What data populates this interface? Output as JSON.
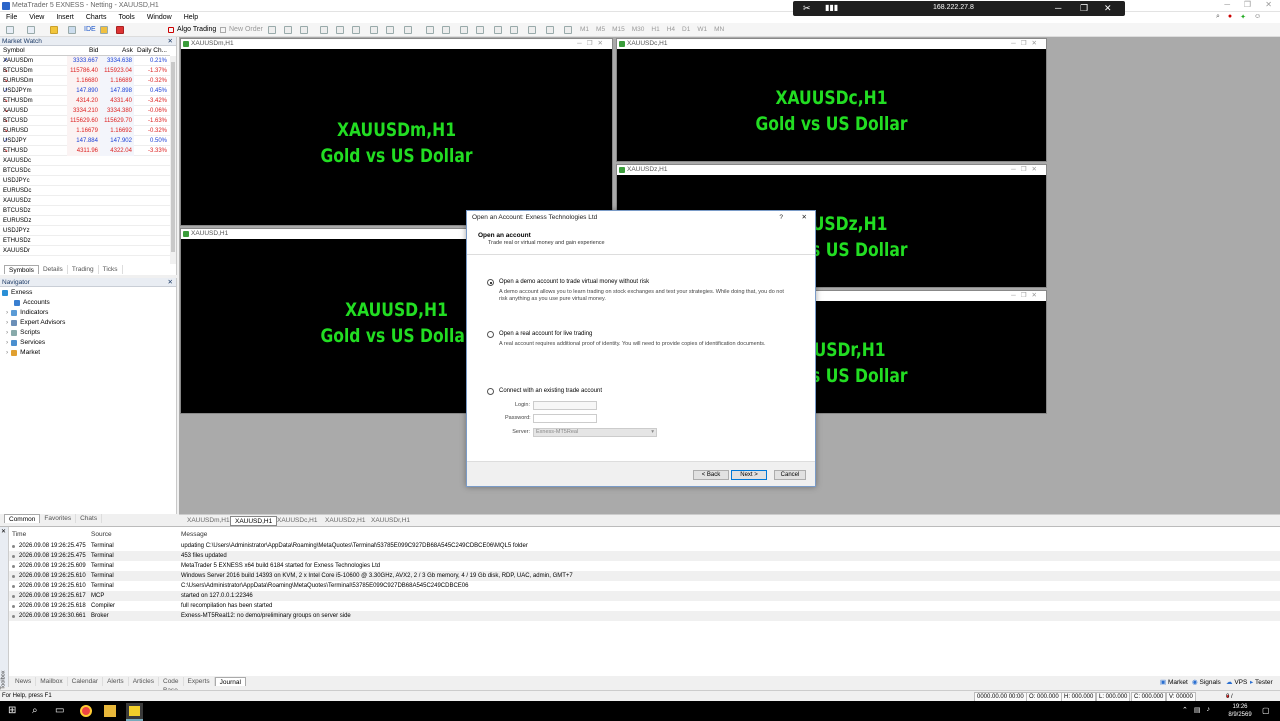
{
  "window": {
    "title": "MetaTrader 5 EXNESS - Netting - XAUUSD,H1"
  },
  "menu": [
    "File",
    "View",
    "Insert",
    "Charts",
    "Tools",
    "Window",
    "Help"
  ],
  "toolbar": {
    "ide": "IDE",
    "algo_trading": "Algo Trading",
    "new_order": "New Order",
    "timeframes": [
      "M1",
      "M5",
      "M15",
      "M30",
      "H1",
      "H4",
      "D1",
      "W1",
      "MN"
    ]
  },
  "rdp": {
    "ip": "168.222.27.8"
  },
  "market_watch": {
    "title": "Market Watch",
    "columns": [
      "Symbol",
      "Bid",
      "Ask",
      "Daily Ch..."
    ],
    "rows": [
      {
        "symbol": "XAUUSDm",
        "bid": "3333.667",
        "ask": "3334.638",
        "change": "0.21%",
        "dir": "up"
      },
      {
        "symbol": "BTCUSDm",
        "bid": "115786.40",
        "ask": "115923.04",
        "change": "-1.37%",
        "dir": "down"
      },
      {
        "symbol": "EURUSDm",
        "bid": "1.16680",
        "ask": "1.16689",
        "change": "-0.32%",
        "dir": "down"
      },
      {
        "symbol": "USDJPYm",
        "bid": "147.890",
        "ask": "147.898",
        "change": "0.45%",
        "dir": "up"
      },
      {
        "symbol": "ETHUSDm",
        "bid": "4314.20",
        "ask": "4331.40",
        "change": "-3.42%",
        "dir": "down"
      },
      {
        "symbol": "XAUUSD",
        "bid": "3334.210",
        "ask": "3334.380",
        "change": "-0.06%",
        "dir": "down"
      },
      {
        "symbol": "BTCUSD",
        "bid": "115629.60",
        "ask": "115629.70",
        "change": "-1.63%",
        "dir": "down"
      },
      {
        "symbol": "EURUSD",
        "bid": "1.16679",
        "ask": "1.16692",
        "change": "-0.32%",
        "dir": "down"
      },
      {
        "symbol": "USDJPY",
        "bid": "147.884",
        "ask": "147.902",
        "change": "0.50%",
        "dir": "up"
      },
      {
        "symbol": "ETHUSD",
        "bid": "4311.96",
        "ask": "4322.04",
        "change": "-3.33%",
        "dir": "down"
      },
      {
        "symbol": "XAUUSDc",
        "bid": "",
        "ask": "",
        "change": "",
        "dir": ""
      },
      {
        "symbol": "BTCUSDc",
        "bid": "",
        "ask": "",
        "change": "",
        "dir": ""
      },
      {
        "symbol": "USDJPYc",
        "bid": "",
        "ask": "",
        "change": "",
        "dir": ""
      },
      {
        "symbol": "EURUSDc",
        "bid": "",
        "ask": "",
        "change": "",
        "dir": ""
      },
      {
        "symbol": "XAUUSDz",
        "bid": "",
        "ask": "",
        "change": "",
        "dir": ""
      },
      {
        "symbol": "BTCUSDz",
        "bid": "",
        "ask": "",
        "change": "",
        "dir": ""
      },
      {
        "symbol": "EURUSDz",
        "bid": "",
        "ask": "",
        "change": "",
        "dir": ""
      },
      {
        "symbol": "USDJPYz",
        "bid": "",
        "ask": "",
        "change": "",
        "dir": ""
      },
      {
        "symbol": "ETHUSDz",
        "bid": "",
        "ask": "",
        "change": "",
        "dir": ""
      },
      {
        "symbol": "XAUUSDr",
        "bid": "",
        "ask": "",
        "change": "",
        "dir": ""
      }
    ],
    "tabs": [
      "Symbols",
      "Details",
      "Trading",
      "Ticks"
    ]
  },
  "navigator": {
    "title": "Navigator",
    "items": [
      "Exness",
      "Accounts",
      "Indicators",
      "Expert Advisors",
      "Scripts",
      "Services",
      "Market"
    ],
    "tabs": [
      "Common",
      "Favorites",
      "Chats"
    ]
  },
  "charts": [
    {
      "header": "XAUUSDm,H1",
      "line1": "XAUUSDm,H1",
      "line2": "Gold vs US Dollar"
    },
    {
      "header": "XAUUSDc,H1",
      "line1": "XAUUSDc,H1",
      "line2": "Gold vs US Dollar"
    },
    {
      "header": "XAUUSDz,H1",
      "line1": "XAUUSDz,H1",
      "line2": "Gold vs US Dollar"
    },
    {
      "header": "XAUUSD,H1",
      "line1": "XAUUSD,H1",
      "line2": "Gold vs US Dollar"
    },
    {
      "header": "",
      "line1": "XAUUSDr,H1",
      "line2": "Gold vs US Dollar"
    }
  ],
  "chart_tabs": [
    "XAUUSDm,H1",
    "XAUUSD,H1",
    "XAUUSDc,H1",
    "XAUUSDz,H1",
    "XAUUSDr,H1"
  ],
  "dialog": {
    "title": "Open an Account: Exness Technologies Ltd",
    "help": "?",
    "close": "✕",
    "heading": "Open an account",
    "subheading": "Trade real or virtual money and gain experience",
    "opt_demo": "Open a demo account to trade virtual money without risk",
    "opt_demo_desc": "A demo account allows you to learn trading on stock exchanges and test your strategies. While doing that, you do not risk anything as you use pure virtual money.",
    "opt_real": "Open a real account for live trading",
    "opt_real_desc": "A real account requires additional proof of identity. You will need to provide copies of identification documents.",
    "opt_existing": "Connect with an existing trade account",
    "login_label": "Login:",
    "password_label": "Password:",
    "server_label": "Server:",
    "server_value": "Exness-MT5Real",
    "back": "< Back",
    "next": "Next >",
    "cancel": "Cancel"
  },
  "journal": {
    "columns": [
      "Time",
      "Source",
      "Message"
    ],
    "rows": [
      {
        "time": "2026.09.08 19:26:25.475",
        "source": "Terminal",
        "message": "updating C:\\Users\\Administrator\\AppData\\Roaming\\MetaQuotes\\Terminal\\53785E099C927DB68A545C249CDBCE06\\MQL5 folder"
      },
      {
        "time": "2026.09.08 19:26:25.475",
        "source": "Terminal",
        "message": "453 files updated"
      },
      {
        "time": "2026.09.08 19:26:25.609",
        "source": "Terminal",
        "message": "MetaTrader 5 EXNESS x64 build 6184 started for Exness Technologies Ltd"
      },
      {
        "time": "2026.09.08 19:26:25.610",
        "source": "Terminal",
        "message": "Windows Server 2016 build 14393 on KVM, 2 x Intel Core i5-10600 @ 3.30GHz, AVX2, 2 / 3 Gb memory, 4 / 19 Gb disk, RDP, UAC, admin, GMT+7"
      },
      {
        "time": "2026.09.08 19:26:25.610",
        "source": "Terminal",
        "message": "C:\\Users\\Administrator\\AppData\\Roaming\\MetaQuotes\\Terminal\\53785E099C927DB68A545C249CDBCE06"
      },
      {
        "time": "2026.09.08 19:26:25.617",
        "source": "MCP",
        "message": "started on 127.0.0.1:22346"
      },
      {
        "time": "2026.09.08 19:26:25.618",
        "source": "Compiler",
        "message": "full recompilation has been started"
      },
      {
        "time": "2026.09.08 19:26:30.661",
        "source": "Broker",
        "message": "Exness-MT5Real12: no demo/preliminary groups on server side"
      }
    ]
  },
  "bottom_tabs": [
    "News",
    "Mailbox",
    "Calendar",
    "Alerts",
    "Articles",
    "Code Base",
    "Experts",
    "Journal"
  ],
  "toolbox_label": "Toolbox",
  "right_links": [
    "Market",
    "Signals",
    "VPS",
    "Tester"
  ],
  "status": {
    "help": "For Help, press F1",
    "datetime": "0000.00.00 00:00",
    "o": "O: 000.000",
    "h": "H: 000.000",
    "l": "L: 000.000",
    "c": "C: 000.000",
    "v": "V: 00000",
    "net": "0 / 0 Kb"
  },
  "clock": {
    "time": "19:26",
    "date": "8/9/2569"
  }
}
